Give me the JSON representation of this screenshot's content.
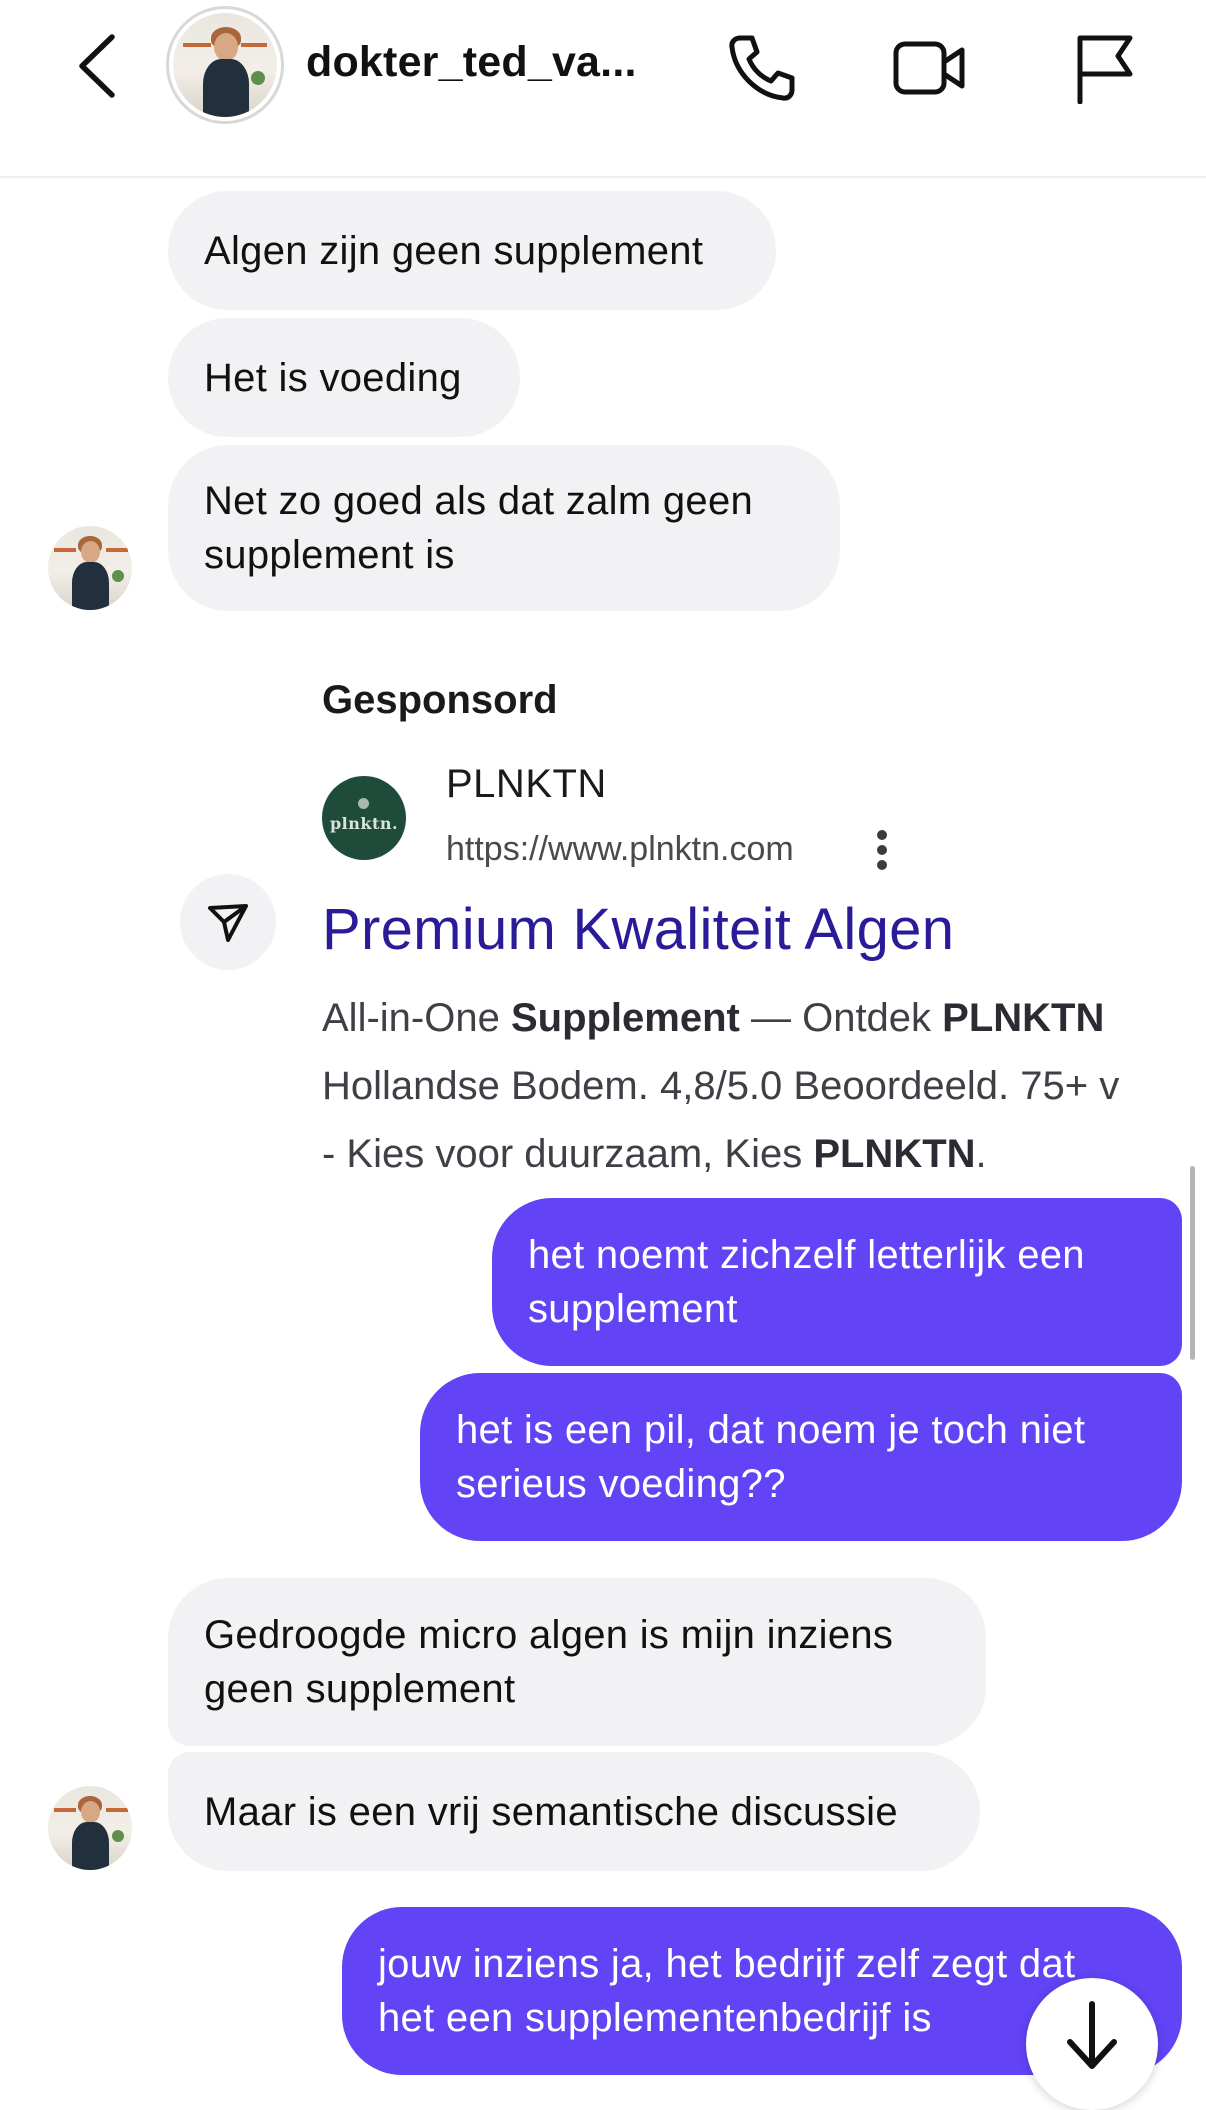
{
  "header": {
    "contact_name": "dokter_ted_va...",
    "icons": {
      "back": "chevron-left-icon",
      "call": "phone-icon",
      "video": "video-camera-icon",
      "report": "flag-icon"
    }
  },
  "messages": [
    {
      "side": "in",
      "text": "Algen zijn geen supplement"
    },
    {
      "side": "in",
      "text": "Het is voeding"
    },
    {
      "side": "in",
      "lines": [
        "Net zo goed als dat zalm geen",
        "supplement is"
      ]
    },
    {
      "side": "out",
      "lines": [
        "het noemt zichzelf letterlijk een",
        "supplement"
      ]
    },
    {
      "side": "out",
      "lines": [
        "het is een pil, dat noem je toch niet",
        "serieus voeding??"
      ]
    },
    {
      "side": "in",
      "lines": [
        "Gedroogde micro algen is mijn inziens",
        "geen supplement"
      ]
    },
    {
      "side": "in",
      "text": "Maar is een vrij semantische discussie"
    },
    {
      "side": "out",
      "lines": [
        "jouw inziens ja, het bedrijf zelf zegt dat",
        "het een supplementenbedrijf is"
      ]
    }
  ],
  "ad": {
    "label": "Gesponsord",
    "logo_text": "plnktn.",
    "brand": "PLNKTN",
    "url": "https://www.plnktn.com",
    "headline": "Premium Kwaliteit Algen",
    "description": {
      "line1": {
        "a": "All-in-One ",
        "b": "Supplement",
        "c": " — Ontdek ",
        "d": "PLNKTN"
      },
      "line2": "Hollandse Bodem. 4,8/5.0 Beoordeeld. 75+ v",
      "line3": {
        "a": "- Kies voor duurzaam, Kies ",
        "b": "PLNKTN",
        "c": "."
      }
    }
  },
  "colors": {
    "incoming_bubble": "#f2f2f4",
    "outgoing_bubble": "#6243f5",
    "ad_headline": "#2a1c98",
    "ad_logo_bg": "#1e4b3a"
  }
}
